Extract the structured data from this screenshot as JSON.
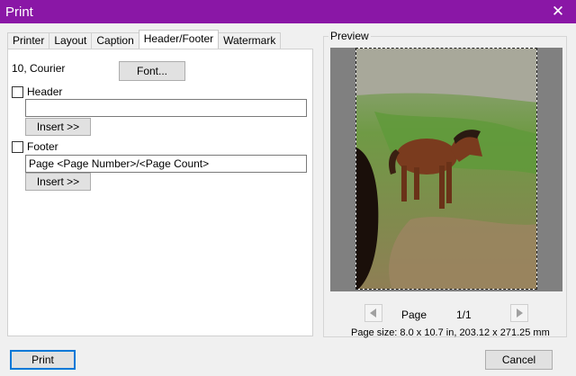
{
  "window": {
    "title": "Print",
    "close_icon": "close-icon"
  },
  "tabs": [
    {
      "label": "Printer",
      "active": false
    },
    {
      "label": "Layout",
      "active": false
    },
    {
      "label": "Caption",
      "active": false
    },
    {
      "label": "Header/Footer",
      "active": true
    },
    {
      "label": "Watermark",
      "active": false
    }
  ],
  "header_footer": {
    "font_description": "10, Courier",
    "font_button": "Font...",
    "header": {
      "label": "Header",
      "checked": false,
      "value": "",
      "insert_button": "Insert >>"
    },
    "footer": {
      "label": "Footer",
      "checked": false,
      "value": "Page <Page Number>/<Page Count>",
      "insert_button": "Insert >>"
    }
  },
  "preview": {
    "group_label": "Preview",
    "page_label": "Page",
    "page_counter": "1/1",
    "page_size": "Page size: 8.0 x 10.7 in, 203.12 x 271.25 mm",
    "prev_icon": "triangle-left-icon",
    "next_icon": "triangle-right-icon"
  },
  "buttons": {
    "print": "Print",
    "cancel": "Cancel"
  },
  "colors": {
    "titlebar": "#8a17a6",
    "default_button_border": "#0078d7",
    "preview_background": "#808080"
  }
}
